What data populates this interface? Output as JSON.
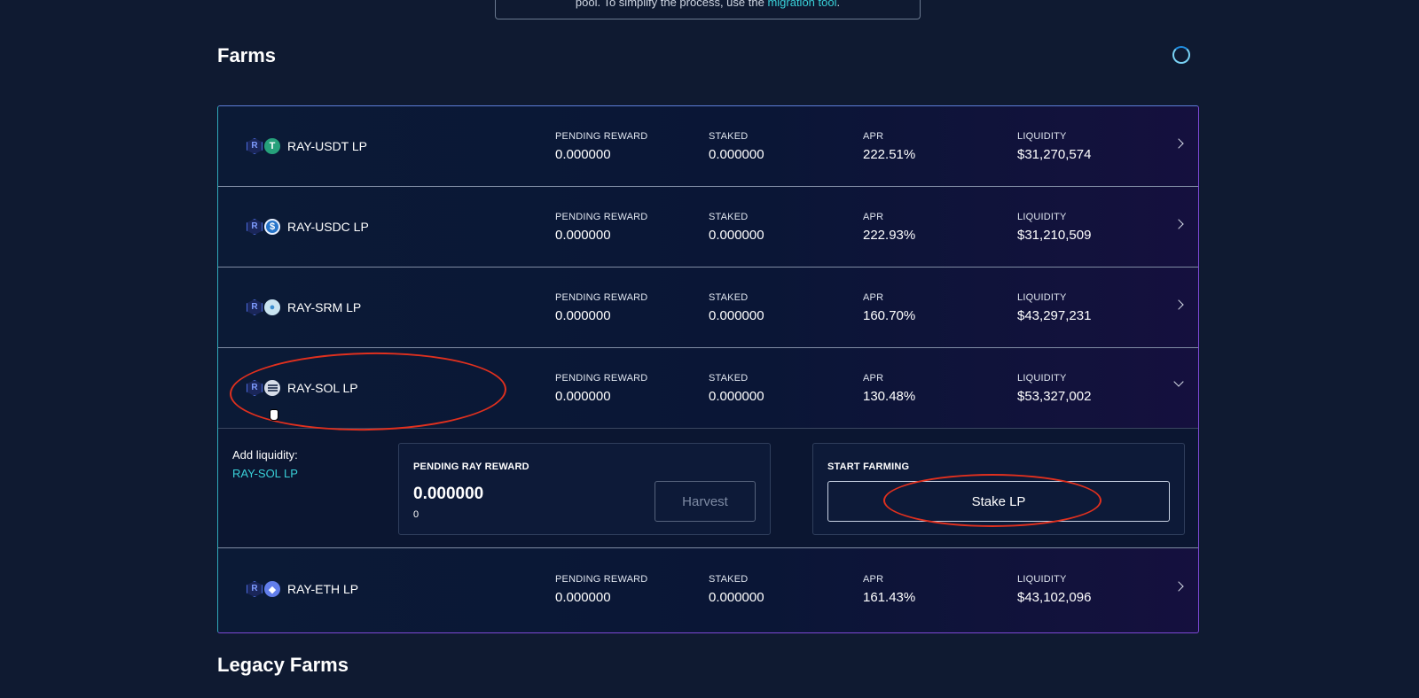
{
  "notice": {
    "text": "pool. To simplify the process, use the ",
    "link": "migration tool",
    "end": "."
  },
  "farms_title": "Farms",
  "legacy_title": "Legacy Farms",
  "labels": {
    "pending_reward": "PENDING REWARD",
    "staked": "STAKED",
    "apr": "APR",
    "liquidity": "LIQUIDITY"
  },
  "farms": [
    {
      "name": "RAY-USDT LP",
      "coin": "usdt",
      "coin_glyph": "T",
      "pending": "0.000000",
      "staked": "0.000000",
      "apr": "222.51%",
      "liquidity": "$31,270,574"
    },
    {
      "name": "RAY-USDC LP",
      "coin": "usdc",
      "coin_glyph": "$",
      "pending": "0.000000",
      "staked": "0.000000",
      "apr": "222.93%",
      "liquidity": "$31,210,509"
    },
    {
      "name": "RAY-SRM LP",
      "coin": "srm",
      "coin_glyph": "●",
      "pending": "0.000000",
      "staked": "0.000000",
      "apr": "160.70%",
      "liquidity": "$43,297,231"
    },
    {
      "name": "RAY-SOL LP",
      "coin": "sol",
      "coin_glyph": "",
      "pending": "0.000000",
      "staked": "0.000000",
      "apr": "130.48%",
      "liquidity": "$53,327,002"
    },
    {
      "name": "RAY-ETH LP",
      "coin": "eth",
      "coin_glyph": "◆",
      "pending": "0.000000",
      "staked": "0.000000",
      "apr": "161.43%",
      "liquidity": "$43,102,096"
    }
  ],
  "expanded": {
    "add_liquidity_label": "Add liquidity:",
    "add_liquidity_link": "RAY-SOL LP",
    "reward_label": "PENDING RAY REWARD",
    "reward_value": "0.000000",
    "reward_sub": "0",
    "harvest_label": "Harvest",
    "start_label": "START FARMING",
    "stake_label": "Stake LP"
  },
  "ray_glyph": "R",
  "colors": {
    "background": "#0f1a31",
    "accent_teal": "#39d0d8",
    "annotation_red": "#e0301e"
  }
}
